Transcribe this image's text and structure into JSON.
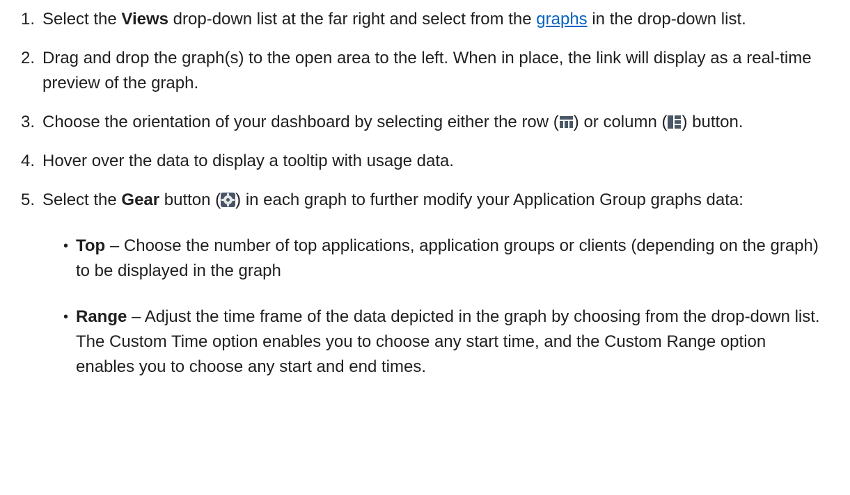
{
  "steps": [
    {
      "num": "1.",
      "text_a": "Select the ",
      "bold": "Views",
      "text_b": " drop-down list at the far right and select from the ",
      "link": "graphs",
      "text_c": " in the drop-down list."
    },
    {
      "num": "2.",
      "text": "Drag and drop the graph(s) to the open area to the left. When in place, the link will display as a real-time preview of the graph."
    },
    {
      "num": "3.",
      "text_a": "Choose the orientation of your dashboard by selecting either the row (",
      "text_b": ") or column (",
      "text_c": ") button.",
      "icon_row": "row-layout-icon",
      "icon_col": "column-layout-icon"
    },
    {
      "num": "4.",
      "text": "Hover over the data to display a tooltip with usage data."
    },
    {
      "num": "5.",
      "text_a": "Select the ",
      "bold": "Gear",
      "text_b": " button (",
      "text_c": ") in each graph to further modify your Application Group graphs data:",
      "icon": "gear-icon"
    }
  ],
  "sub_items": [
    {
      "bullet": "•",
      "term": "Top",
      "text": " – Choose the number of top applications, application groups or clients (depending on the graph) to be displayed in the graph"
    },
    {
      "bullet": "•",
      "term": "Range",
      "text": " – Adjust the time frame of the data depicted in the graph by choosing from the drop-down list. The Custom Time option enables you to choose any start time, and the Custom Range option enables you to choose any start and end times."
    }
  ],
  "colors": {
    "text": "#1f1f1f",
    "link": "#0563c1",
    "icon": "#4a5866"
  }
}
